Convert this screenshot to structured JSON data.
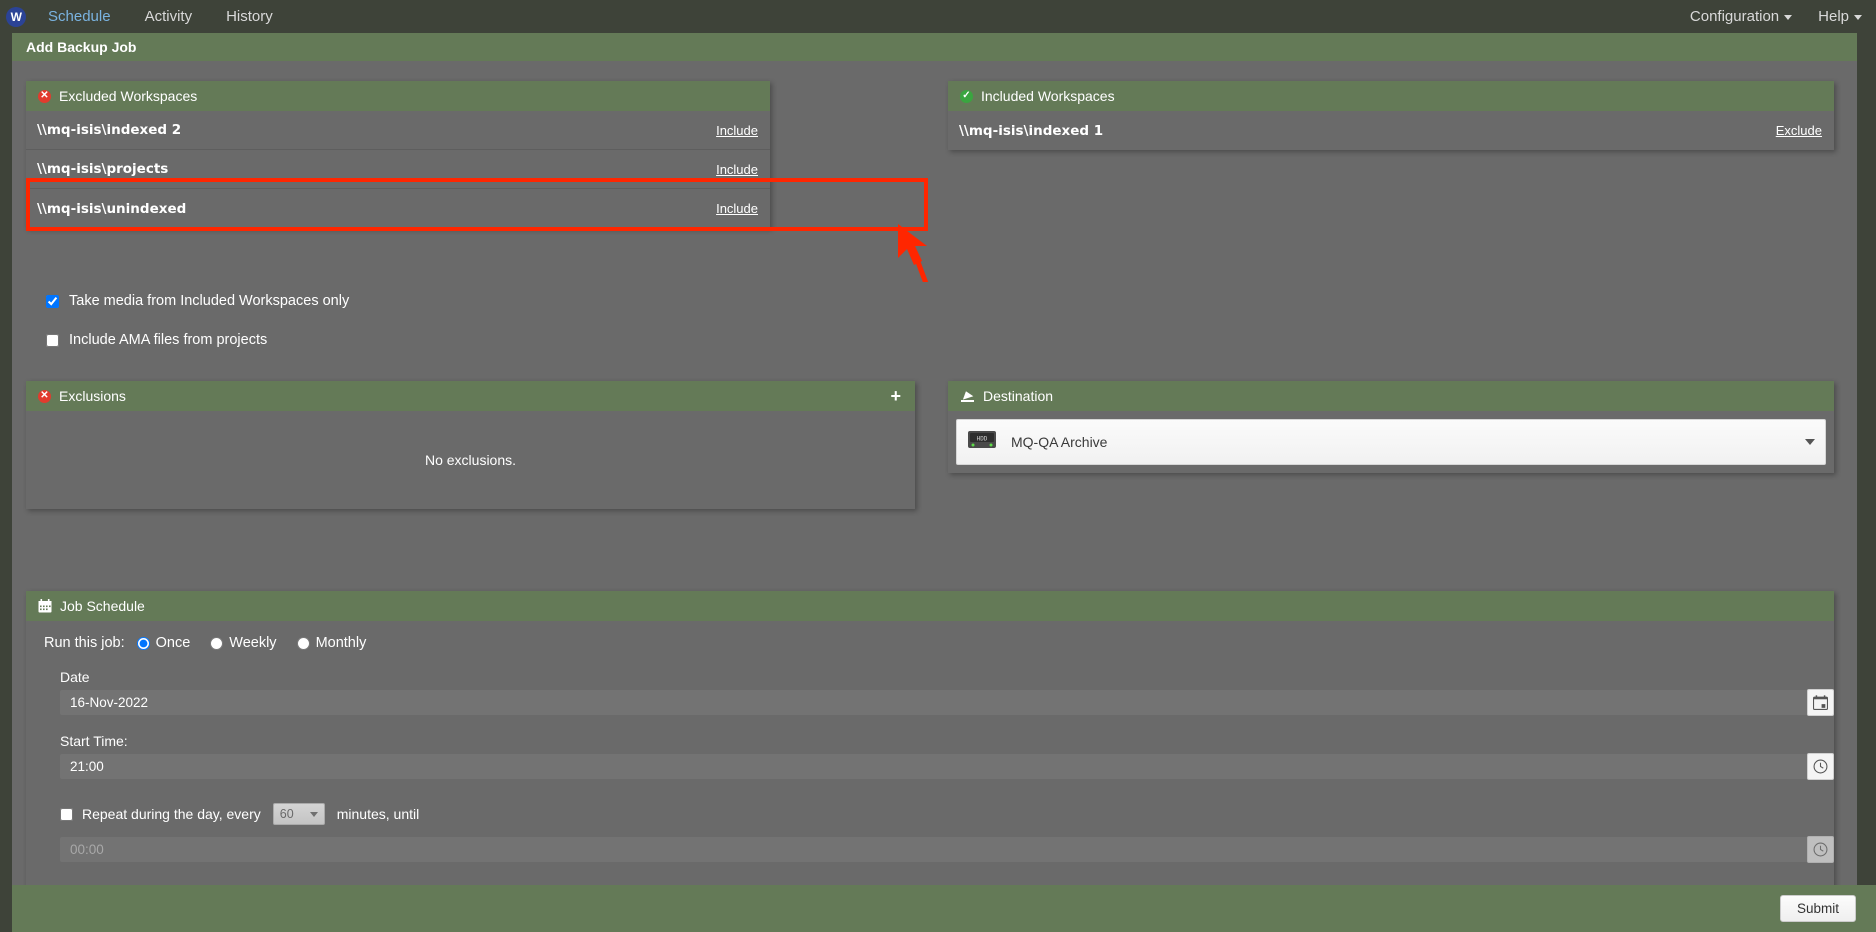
{
  "topnav": {
    "logo_text": "W",
    "left_items": [
      {
        "label": "Schedule",
        "active": true
      },
      {
        "label": "Activity",
        "active": false
      },
      {
        "label": "History",
        "active": false
      }
    ],
    "right_items": [
      {
        "label": "Configuration"
      },
      {
        "label": "Help"
      }
    ]
  },
  "page": {
    "title": "Add Backup Job"
  },
  "excluded_workspaces": {
    "title": "Excluded Workspaces",
    "icon": "error-circle-icon",
    "accent": "#e23b2e",
    "rows": [
      {
        "name": "\\\\mq-isis\\indexed 2",
        "action": "Include"
      },
      {
        "name": "\\\\mq-isis\\projects",
        "action": "Include",
        "highlighted": true
      },
      {
        "name": "\\\\mq-isis\\unindexed",
        "action": "Include"
      }
    ]
  },
  "included_workspaces": {
    "title": "Included Workspaces",
    "icon": "check-circle-icon",
    "accent": "#3aa540",
    "rows": [
      {
        "name": "\\\\mq-isis\\indexed 1",
        "action": "Exclude"
      }
    ]
  },
  "options": [
    {
      "label": "Take media from Included Workspaces only",
      "checked": true
    },
    {
      "label": "Include AMA files from projects",
      "checked": false
    }
  ],
  "exclusions": {
    "title": "Exclusions",
    "icon": "error-circle-icon",
    "add_label": "+",
    "empty_text": "No exclusions."
  },
  "destination": {
    "title": "Destination",
    "icon": "eject-icon",
    "selected": "MQ-QA Archive",
    "device_icon": "hdd-icon"
  },
  "job_schedule": {
    "title": "Job Schedule",
    "icon": "calendar-icon",
    "run_label": "Run this job:",
    "frequencies": [
      {
        "label": "Once",
        "selected": true
      },
      {
        "label": "Weekly",
        "selected": false
      },
      {
        "label": "Monthly",
        "selected": false
      }
    ],
    "date_label": "Date",
    "date_value": "16-Nov-2022",
    "date_picker_icon": "calendar-icon",
    "start_time_label": "Start Time:",
    "start_time_value": "21:00",
    "start_time_picker_icon": "clock-icon",
    "repeat": {
      "checked": false,
      "prefix_label": "Repeat during the day,  every",
      "interval_value": "60",
      "suffix_label": "minutes,  until",
      "until_value": "00:00",
      "until_picker_icon": "clock-icon"
    }
  },
  "footer": {
    "submit_label": "Submit"
  }
}
